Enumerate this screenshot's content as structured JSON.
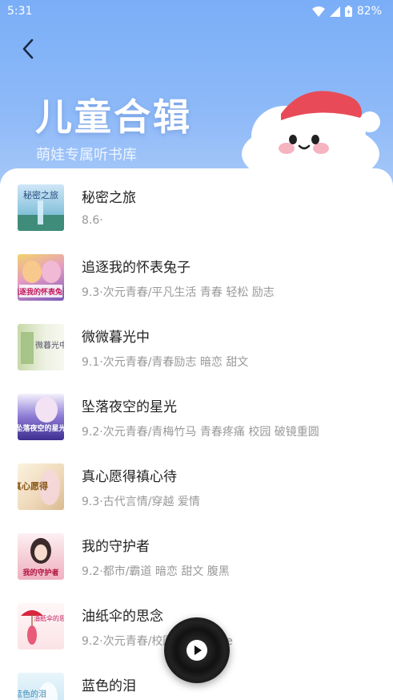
{
  "status": {
    "time": "5:31",
    "battery": "82%"
  },
  "header": {
    "title": "儿童合辑",
    "subtitle": "萌娃专属听书库"
  },
  "books": [
    {
      "title": "秘密之旅",
      "meta": "8.6·",
      "cover_text": "秘密之旅"
    },
    {
      "title": "追逐我的怀表兔子",
      "meta": "9.3·次元青春/平凡生活 青春 轻松 励志",
      "cover_text": "追逐我的怀表兔子"
    },
    {
      "title": "微微暮光中",
      "meta": "9.1·次元青春/青春励志 暗恋 甜文",
      "cover_text": "微暮光中"
    },
    {
      "title": "坠落夜空的星光",
      "meta": "9.2·次元青春/青梅竹马 青春疼痛 校园 破镜重圆",
      "cover_text": "坠落夜空的星光"
    },
    {
      "title": "真心愿得禛心待",
      "meta": "9.3·古代言情/穿越 爱情",
      "cover_text": "真心愿得"
    },
    {
      "title": "我的守护者",
      "meta": "9.2·都市/霸道 暗恋 甜文 腹黑",
      "cover_text": "我的守护者"
    },
    {
      "title": "油纸伞的思念",
      "meta": "9.2·次元青春/校园，虐恋，he",
      "cover_text": "油纸伞的思念"
    },
    {
      "title": "蓝色的泪",
      "meta": "",
      "cover_text": "蓝色的泪"
    }
  ],
  "colors": {
    "hero": "#7aaef7",
    "title": "#222222",
    "meta": "#999999"
  }
}
